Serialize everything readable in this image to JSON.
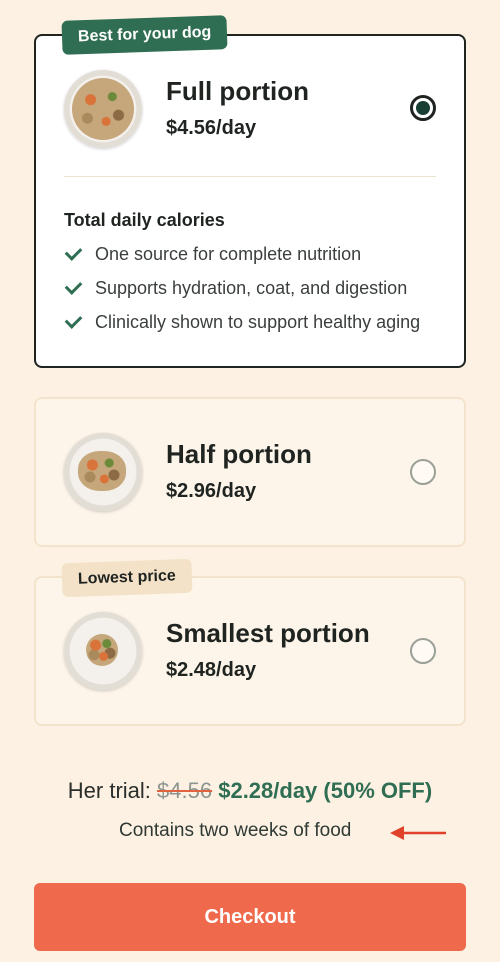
{
  "plans": [
    {
      "badge": "Best for your dog",
      "title": "Full portion",
      "price": "$4.56/day",
      "selected": true,
      "section_title": "Total daily calories",
      "benefits": [
        "One source for complete nutrition",
        "Supports hydration, coat, and digestion",
        "Clinically shown to support healthy aging"
      ]
    },
    {
      "title": "Half portion",
      "price": "$2.96/day",
      "selected": false
    },
    {
      "badge": "Lowest price",
      "title": "Smallest portion",
      "price": "$2.48/day",
      "selected": false
    }
  ],
  "trial": {
    "label": "Her trial:",
    "old_price": "$4.56",
    "new_price": "$2.28/day (50% OFF)",
    "note": "Contains two weeks of food"
  },
  "checkout_label": "Checkout",
  "colors": {
    "background": "#fdf1e3",
    "brand_green": "#2f6e53",
    "accent_orange": "#ef6a4c",
    "selected_dot": "#173f33"
  }
}
